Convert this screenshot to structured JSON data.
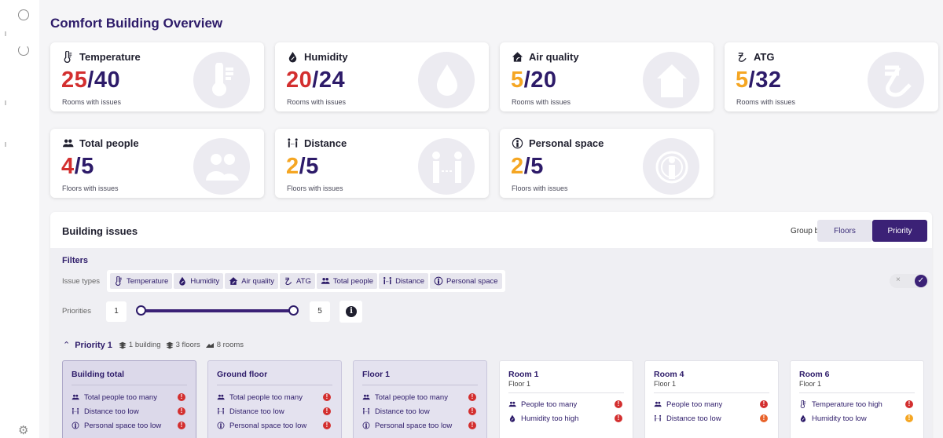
{
  "page": {
    "title": "Comfort Building Overview"
  },
  "colors": {
    "brand": "#2d1b69",
    "critical": "#d32f2f",
    "warning": "#f5a623",
    "high": "#e8632b"
  },
  "kpis": [
    {
      "icon": "thermometer-icon",
      "label": "Temperature",
      "num": "25",
      "total": "/40",
      "sub": "Rooms with issues",
      "color": "#d32f2f"
    },
    {
      "icon": "humidity-icon",
      "label": "Humidity",
      "num": "20",
      "total": "/24",
      "sub": "Rooms with issues",
      "color": "#d32f2f"
    },
    {
      "icon": "house-icon",
      "label": "Air quality",
      "num": "5",
      "total": "/20",
      "sub": "Rooms with issues",
      "color": "#f5a623"
    },
    {
      "icon": "atg-icon",
      "label": "ATG",
      "num": "5",
      "total": "/32",
      "sub": "Rooms with issues",
      "color": "#f5a623"
    },
    {
      "icon": "people-icon",
      "label": "Total people",
      "num": "4",
      "total": "/5",
      "sub": "Floors with issues",
      "color": "#d32f2f"
    },
    {
      "icon": "distance-icon",
      "label": "Distance",
      "num": "2",
      "total": "/5",
      "sub": "Floors with issues",
      "color": "#f5a623"
    },
    {
      "icon": "personal-space-icon",
      "label": "Personal space",
      "num": "2",
      "total": "/5",
      "sub": "Floors with issues",
      "color": "#f5a623"
    }
  ],
  "issues": {
    "title": "Building issues",
    "group_by_label": "Group by",
    "group_options": [
      "Floors",
      "Priority"
    ],
    "selected_group": "Priority",
    "filters_label": "Filters",
    "issue_types_label": "Issue types",
    "issue_types": [
      "Temperature",
      "Humidity",
      "Air quality",
      "ATG",
      "Total people",
      "Distance",
      "Personal space"
    ],
    "toggle_clear": "×",
    "toggle_check": "✓",
    "priorities_label": "Priorities",
    "priority_min": "1",
    "priority_max": "5",
    "priority_group": {
      "title": "Priority 1",
      "buildings": "1 building",
      "floors": "3 floors",
      "rooms": "8 rooms"
    },
    "cards": [
      {
        "title": "Building total",
        "sub": "",
        "kind": "agg",
        "selected": true,
        "items": [
          {
            "icon": "people-icon",
            "text": "Total people too many",
            "level": "critical"
          },
          {
            "icon": "distance-icon",
            "text": "Distance too low",
            "level": "critical"
          },
          {
            "icon": "personal-space-icon",
            "text": "Personal space too low",
            "level": "critical"
          }
        ]
      },
      {
        "title": "Ground floor",
        "sub": "",
        "kind": "agg",
        "selected": false,
        "items": [
          {
            "icon": "people-icon",
            "text": "Total people too many",
            "level": "critical"
          },
          {
            "icon": "distance-icon",
            "text": "Distance too low",
            "level": "critical"
          },
          {
            "icon": "personal-space-icon",
            "text": "Personal space too low",
            "level": "critical"
          }
        ]
      },
      {
        "title": "Floor 1",
        "sub": "",
        "kind": "agg",
        "selected": false,
        "items": [
          {
            "icon": "people-icon",
            "text": "Total people too many",
            "level": "critical"
          },
          {
            "icon": "distance-icon",
            "text": "Distance too low",
            "level": "critical"
          },
          {
            "icon": "personal-space-icon",
            "text": "Personal space too low",
            "level": "critical"
          }
        ]
      },
      {
        "title": "Room 1",
        "sub": "Floor 1",
        "kind": "room",
        "selected": false,
        "items": [
          {
            "icon": "people-icon",
            "text": "People too many",
            "level": "critical"
          },
          {
            "icon": "humidity-icon",
            "text": "Humidity too high",
            "level": "critical"
          }
        ]
      },
      {
        "title": "Room 4",
        "sub": "Floor 1",
        "kind": "room",
        "selected": false,
        "items": [
          {
            "icon": "people-icon",
            "text": "People too many",
            "level": "critical"
          },
          {
            "icon": "distance-icon",
            "text": "Distance too low",
            "level": "high"
          }
        ]
      },
      {
        "title": "Room 6",
        "sub": "Floor 1",
        "kind": "room",
        "selected": false,
        "items": [
          {
            "icon": "thermometer-icon",
            "text": "Temperature too high",
            "level": "critical"
          },
          {
            "icon": "humidity-icon",
            "text": "Humidity too low",
            "level": "warning"
          }
        ]
      }
    ]
  }
}
